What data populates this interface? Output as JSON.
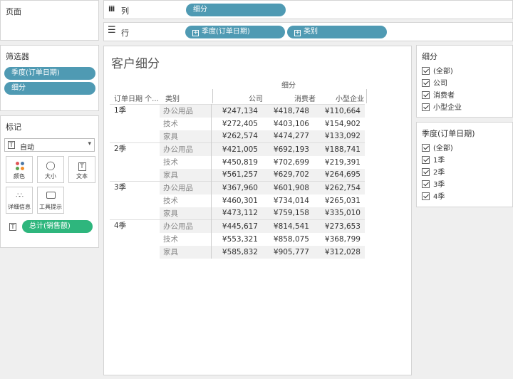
{
  "pages": {
    "title": "页面"
  },
  "shelves": {
    "columns_label": "列",
    "rows_label": "行",
    "columns_pills": [
      "细分"
    ],
    "rows_pills": [
      "季度(订单日期)",
      "类别"
    ]
  },
  "filters": {
    "title": "筛选器",
    "pills": [
      "季度(订单日期)",
      "细分"
    ]
  },
  "marks": {
    "title": "标记",
    "type": "自动",
    "buttons": [
      "颜色",
      "大小",
      "文本",
      "详细信息",
      "工具提示"
    ],
    "text_pill": "总计(销售额)"
  },
  "view": {
    "title": "客户细分",
    "column_group": "细分",
    "row_headers": [
      "订单日期 个...",
      "类别"
    ],
    "segments": [
      "公司",
      "消费者",
      "小型企业"
    ],
    "quarters": [
      {
        "label": "1季",
        "rows": [
          {
            "cat": "办公用品",
            "vals": [
              "¥247,134",
              "¥418,748",
              "¥110,664"
            ]
          },
          {
            "cat": "技术",
            "vals": [
              "¥272,405",
              "¥403,106",
              "¥154,902"
            ]
          },
          {
            "cat": "家具",
            "vals": [
              "¥262,574",
              "¥474,277",
              "¥133,092"
            ]
          }
        ]
      },
      {
        "label": "2季",
        "rows": [
          {
            "cat": "办公用品",
            "vals": [
              "¥421,005",
              "¥692,193",
              "¥188,741"
            ]
          },
          {
            "cat": "技术",
            "vals": [
              "¥450,819",
              "¥702,699",
              "¥219,391"
            ]
          },
          {
            "cat": "家具",
            "vals": [
              "¥561,257",
              "¥629,702",
              "¥264,695"
            ]
          }
        ]
      },
      {
        "label": "3季",
        "rows": [
          {
            "cat": "办公用品",
            "vals": [
              "¥367,960",
              "¥601,908",
              "¥262,754"
            ]
          },
          {
            "cat": "技术",
            "vals": [
              "¥460,301",
              "¥734,014",
              "¥265,031"
            ]
          },
          {
            "cat": "家具",
            "vals": [
              "¥473,112",
              "¥759,158",
              "¥335,010"
            ]
          }
        ]
      },
      {
        "label": "4季",
        "rows": [
          {
            "cat": "办公用品",
            "vals": [
              "¥445,617",
              "¥814,541",
              "¥273,653"
            ]
          },
          {
            "cat": "技术",
            "vals": [
              "¥553,321",
              "¥858,075",
              "¥368,799"
            ]
          },
          {
            "cat": "家具",
            "vals": [
              "¥585,832",
              "¥905,777",
              "¥312,028"
            ]
          }
        ]
      }
    ]
  },
  "legend_segment": {
    "title": "细分",
    "items": [
      "(全部)",
      "公司",
      "消费者",
      "小型企业"
    ]
  },
  "legend_quarter": {
    "title": "季度(订单日期)",
    "items": [
      "(全部)",
      "1季",
      "2季",
      "3季",
      "4季"
    ]
  },
  "colors": {
    "pill": "#4f9ab3",
    "pill_green": "#2eb67d"
  }
}
